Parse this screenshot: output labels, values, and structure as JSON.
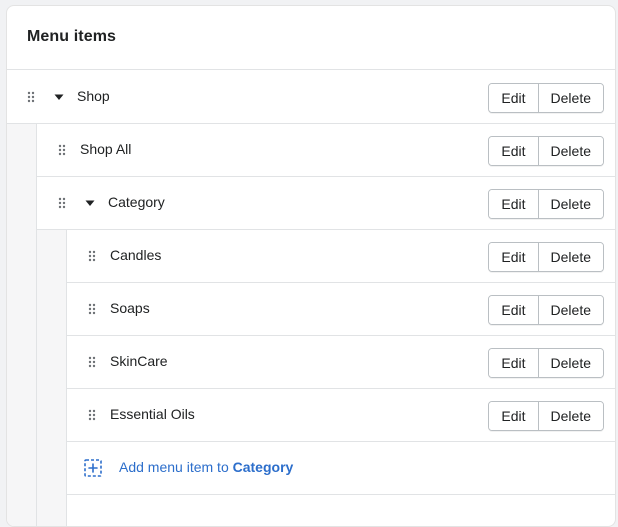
{
  "card": {
    "title": "Menu items"
  },
  "menu_items": [
    {
      "label": "Shop",
      "edit_label": "Edit",
      "delete_label": "Delete",
      "expanded": true,
      "level": 0
    },
    {
      "label": "Shop All",
      "edit_label": "Edit",
      "delete_label": "Delete",
      "level": 1
    },
    {
      "label": "Category",
      "edit_label": "Edit",
      "delete_label": "Delete",
      "expanded": true,
      "level": 1
    },
    {
      "label": "Candles",
      "edit_label": "Edit",
      "delete_label": "Delete",
      "level": 2
    },
    {
      "label": "Soaps",
      "edit_label": "Edit",
      "delete_label": "Delete",
      "level": 2
    },
    {
      "label": "SkinCare",
      "edit_label": "Edit",
      "delete_label": "Delete",
      "level": 2
    },
    {
      "label": "Essential Oils",
      "edit_label": "Edit",
      "delete_label": "Delete",
      "level": 2
    }
  ],
  "add_item": {
    "prefix": "Add menu item to ",
    "target": "Category",
    "icon": "add-square-icon"
  },
  "icons": {
    "drag": "drag-handle-icon",
    "caret": "caret-down-icon"
  },
  "colors": {
    "link": "#2c6ecb",
    "text": "#202223",
    "border": "#e1e3e5",
    "gutter": "#f6f6f7"
  }
}
